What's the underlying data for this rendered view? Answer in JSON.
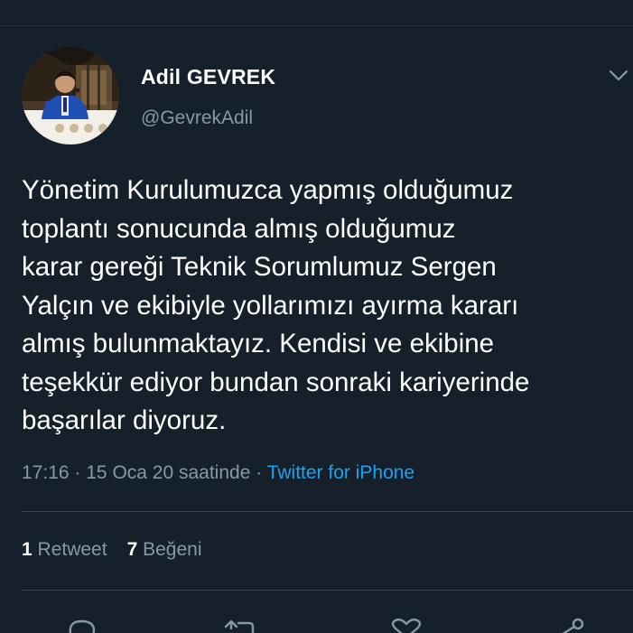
{
  "user": {
    "display_name": "Adil GEVREK",
    "handle": "@GevrekAdil"
  },
  "tweet": {
    "text": "Yönetim Kurulumuzca yapmış olduğumuz\ntoplantı sonucunda almış olduğumuz\nkarar gereği Teknik Sorumlumuz Sergen\nYalçın ve ekibiyle yollarımızı ayırma kararı\nalmış bulunmaktayız. Kendisi ve ekibine\nteşekkür ediyor bundan sonraki kariyerinde\nbaşarılar diyoruz.",
    "time": "17:16",
    "date": "15 Oca 20 saatinde",
    "separator": "·",
    "source": "Twitter for iPhone"
  },
  "stats": {
    "retweet_count": "1",
    "retweet_label": "Retweet",
    "like_count": "7",
    "like_label": "Beğeni"
  },
  "icons": {
    "caret": "chevron-down-icon",
    "reply": "reply-icon",
    "retweet": "retweet-icon",
    "like": "heart-icon",
    "share": "share-icon"
  },
  "colors": {
    "background": "#15202b",
    "text": "#ffffff",
    "muted": "#8899a6",
    "accent": "#1da1f2",
    "divider": "#38444d"
  }
}
